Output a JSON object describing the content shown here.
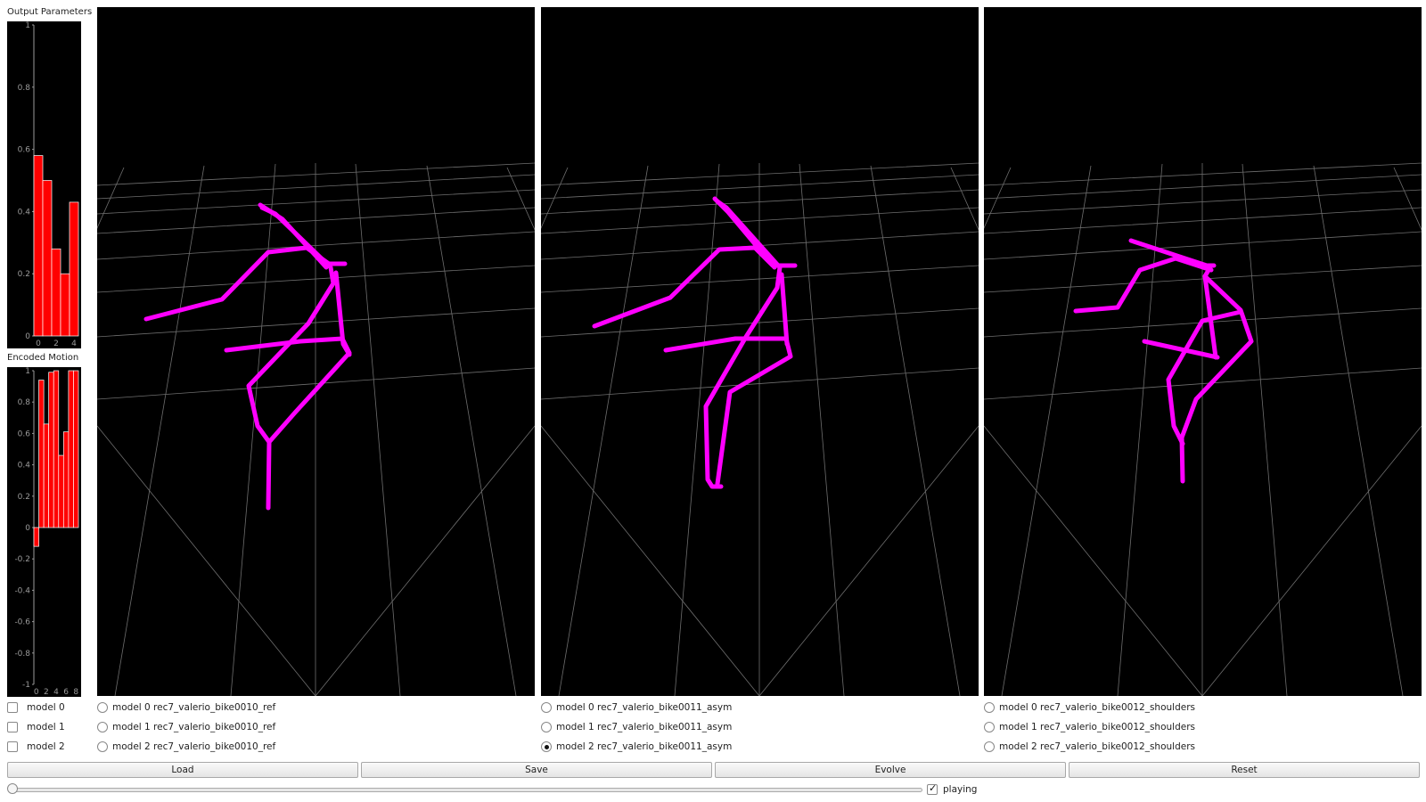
{
  "output_params": {
    "label": "Output Parameters",
    "chart_data": {
      "type": "bar",
      "x": [
        0,
        1,
        2,
        3,
        4
      ],
      "values": [
        0.58,
        0.5,
        0.28,
        0.2,
        0.43
      ],
      "ylim": [
        0,
        1
      ],
      "yticks": [
        "0",
        "0.2",
        "0.4",
        "0.6",
        "0.8",
        "1"
      ],
      "xticks": [
        "0",
        "2",
        "4"
      ],
      "bar_color": "#ff0000"
    }
  },
  "encoded_motion": {
    "label": "Encoded Motion",
    "chart_data": {
      "type": "bar",
      "x": [
        0,
        1,
        2,
        3,
        4,
        5,
        6,
        7,
        8
      ],
      "values": [
        -0.12,
        0.94,
        0.66,
        0.99,
        1.0,
        0.46,
        0.61,
        1.0,
        1.0
      ],
      "ylim": [
        -1,
        1
      ],
      "yticks": [
        "-1",
        "-0.8",
        "-0.6",
        "-0.4",
        "-0.2",
        "0",
        "0.2",
        "0.4",
        "0.6",
        "0.8",
        "1"
      ],
      "xticks": [
        "0",
        "2",
        "4",
        "6",
        "8"
      ],
      "bar_color": "#ff0000"
    }
  },
  "skeleton_color": "#ff00ff",
  "model_checkboxes": [
    {
      "label": "model 0",
      "checked": false
    },
    {
      "label": "model 1",
      "checked": false
    },
    {
      "label": "model 2",
      "checked": false
    }
  ],
  "viewports": [
    {
      "radios": [
        {
          "label": "model 0 rec7_valerio_bike0010_ref",
          "checked": false
        },
        {
          "label": "model 1 rec7_valerio_bike0010_ref",
          "checked": false
        },
        {
          "label": "model 2 rec7_valerio_bike0010_ref",
          "checked": false
        }
      ]
    },
    {
      "radios": [
        {
          "label": "model 0 rec7_valerio_bike0011_asym",
          "checked": false
        },
        {
          "label": "model 1 rec7_valerio_bike0011_asym",
          "checked": false
        },
        {
          "label": "model 2 rec7_valerio_bike0011_asym",
          "checked": true
        }
      ]
    },
    {
      "radios": [
        {
          "label": "model 0 rec7_valerio_bike0012_shoulders",
          "checked": false
        },
        {
          "label": "model 1 rec7_valerio_bike0012_shoulders",
          "checked": false
        },
        {
          "label": "model 2 rec7_valerio_bike0012_shoulders",
          "checked": false
        }
      ]
    }
  ],
  "buttons": {
    "load": "Load",
    "save": "Save",
    "evolve": "Evolve",
    "reset": "Reset"
  },
  "playback": {
    "label": "playing",
    "checked": true,
    "position": 0
  }
}
